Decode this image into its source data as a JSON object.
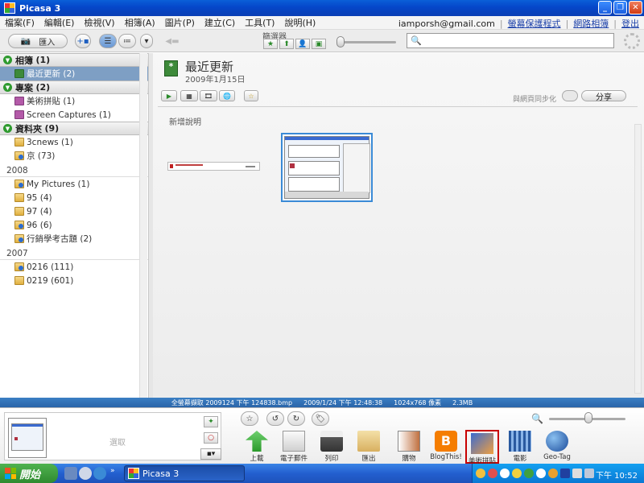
{
  "window": {
    "title": "Picasa 3"
  },
  "menu": {
    "items": [
      "檔案(F)",
      "編輯(E)",
      "檢視(V)",
      "相簿(A)",
      "圖片(P)",
      "建立(C)",
      "工具(T)",
      "說明(H)"
    ],
    "account": "iamporsh@gmail.com",
    "screensaver_link": "螢幕保護程式",
    "webalbums_link": "網路相簿",
    "signout_link": "登出"
  },
  "toolbar": {
    "import_label": "匯入",
    "filter_label": "篩選器",
    "search_placeholder": ""
  },
  "sidebar": {
    "groups": [
      {
        "label": "相簿",
        "count": "(1)",
        "items": [
          {
            "label": "最近更新",
            "count": "(2)",
            "selected": true
          }
        ]
      },
      {
        "label": "專案",
        "count": "(2)",
        "items": [
          {
            "label": "美術拼貼",
            "count": "(1)"
          },
          {
            "label": "Screen Captures",
            "count": "(1)"
          }
        ]
      },
      {
        "label": "資料夾",
        "count": "(9)",
        "items": [
          {
            "label": "3cnews",
            "count": "(1)"
          },
          {
            "label": "京",
            "count": "(73)"
          }
        ]
      }
    ],
    "year2008": "2008",
    "items2008": [
      {
        "label": "My Pictures",
        "count": "(1)"
      },
      {
        "label": "95",
        "count": "(4)"
      },
      {
        "label": "97",
        "count": "(4)"
      },
      {
        "label": "96",
        "count": "(6)"
      },
      {
        "label": "行銷學考古題",
        "count": "(2)"
      }
    ],
    "year2007": "2007",
    "items2007": [
      {
        "label": "0216",
        "count": "(111)"
      },
      {
        "label": "0219",
        "count": "(601)"
      }
    ]
  },
  "main": {
    "album_title": "最近更新",
    "album_date": "2009年1月15日",
    "sync_label": "與網頁同步化",
    "share_label": "分享",
    "add_caption": "新增說明"
  },
  "infostrip": {
    "filename": "全螢幕擷取 2009124 下午 124838.bmp",
    "datetime": "2009/1/24 下午 12:48:38",
    "dimensions": "1024x768 像素",
    "size": "2.3MB"
  },
  "tray": {
    "selection_text": "選取",
    "actions": [
      "上載",
      "電子郵件",
      "列印",
      "匯出",
      "購物",
      "BlogThis!",
      "美術拼貼",
      "電影",
      "Geo-Tag"
    ]
  },
  "taskbar": {
    "start_label": "開始",
    "task_label": "Picasa 3",
    "clock": "下午 10:52"
  }
}
